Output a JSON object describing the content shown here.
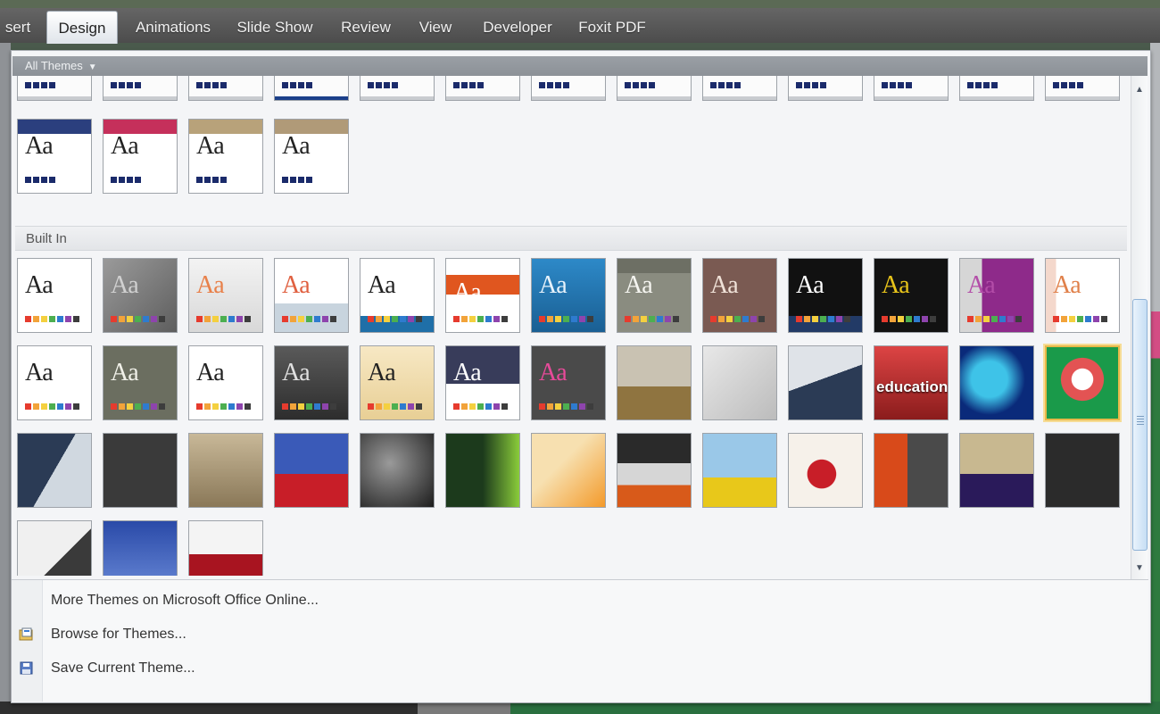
{
  "ribbon": {
    "tabs": [
      {
        "label": "sert",
        "active": false
      },
      {
        "label": "Design",
        "active": true
      },
      {
        "label": "Animations",
        "active": false
      },
      {
        "label": "Slide Show",
        "active": false
      },
      {
        "label": "Review",
        "active": false
      },
      {
        "label": "View",
        "active": false
      },
      {
        "label": "Developer",
        "active": false
      },
      {
        "label": "Foxit PDF",
        "active": false
      }
    ]
  },
  "panel": {
    "title": "All Themes",
    "caret": "▼",
    "custom_sample_text": "Aa",
    "builtin_header": "Built In",
    "selected_builtin_index": 25,
    "builtin_sample_text": "Aa",
    "educational_theme_text": "education"
  },
  "menu": {
    "items": [
      {
        "label": "More Themes on Microsoft Office Online...",
        "icon": "none"
      },
      {
        "label": "Browse for Themes...",
        "icon": "folder-icon"
      },
      {
        "label": "Save Current Theme...",
        "icon": "save-theme-icon"
      }
    ]
  },
  "scrollbar": {
    "up": "▲",
    "down": "▼"
  },
  "colors": {
    "panel_bg": "#f4f5f7",
    "header_bar": "#8c9197",
    "selected_border": "#e8b84a",
    "scroll_thumb": "#c7def4"
  }
}
